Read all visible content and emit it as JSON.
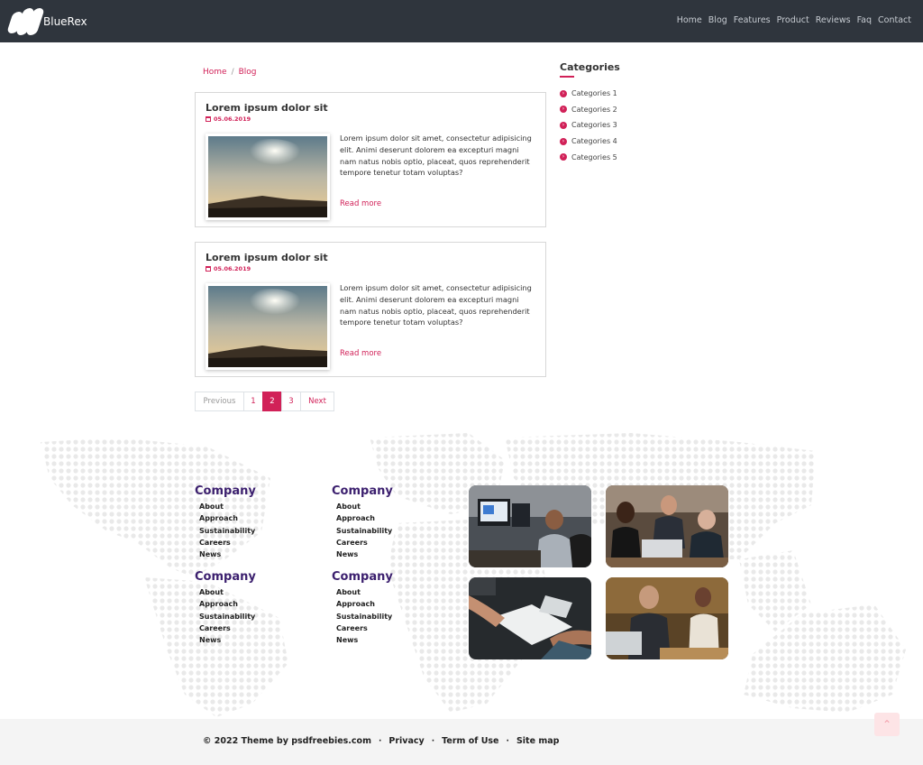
{
  "brand": {
    "name": "BlueRex"
  },
  "nav": [
    "Home",
    "Blog",
    "Features",
    "Product",
    "Reviews",
    "Faq",
    "Contact"
  ],
  "breadcrumb": {
    "home": "Home",
    "separator": "/",
    "current": "Blog"
  },
  "posts": [
    {
      "title": "Lorem ipsum dolor sit",
      "date": "05.06.2019",
      "text": "Lorem ipsum dolor sit amet, consectetur adipisicing elit. Animi deserunt dolorem ea excepturi magni nam natus nobis optio, placeat, quos reprehenderit tempore tenetur totam voluptas?",
      "link": "Read more"
    },
    {
      "title": "Lorem ipsum dolor sit",
      "date": "05.06.2019",
      "text": "Lorem ipsum dolor sit amet, consectetur adipisicing elit. Animi deserunt dolorem ea excepturi magni nam natus nobis optio, placeat, quos reprehenderit tempore tenetur totam voluptas?",
      "link": "Read more"
    }
  ],
  "pagination": {
    "prev": "Previous",
    "pages": [
      "1",
      "2",
      "3"
    ],
    "active": "2",
    "next": "Next"
  },
  "sidebar": {
    "title": "Categories",
    "items": [
      "Categories 1",
      "Categories 2",
      "Categories 3",
      "Categories 4",
      "Categories 5"
    ]
  },
  "footer": {
    "columns": [
      {
        "heading": "Company",
        "links": [
          "About",
          "Approach",
          "Sustainability",
          "Careers",
          "News"
        ]
      },
      {
        "heading": "Company",
        "links": [
          "About",
          "Approach",
          "Sustainability",
          "Careers",
          "News"
        ]
      },
      {
        "heading": "Company",
        "links": [
          "About",
          "Approach",
          "Sustainability",
          "Careers",
          "News"
        ]
      },
      {
        "heading": "Company",
        "links": [
          "About",
          "Approach",
          "Sustainability",
          "Careers",
          "News"
        ]
      }
    ]
  },
  "bottom": {
    "copyright": "© 2022 Theme by psdfreebies.com",
    "separator": "·",
    "privacy": "Privacy",
    "terms": "Term of Use",
    "sitemap": "Site map"
  },
  "colors": {
    "accent": "#d12158",
    "nav_bg": "#2f353d",
    "heading_purple": "#3b1f6e"
  },
  "icons": {
    "calendar": "calendar-icon",
    "category": "chevron-circle-right-icon",
    "scroll_top": "chevron-up-icon"
  }
}
